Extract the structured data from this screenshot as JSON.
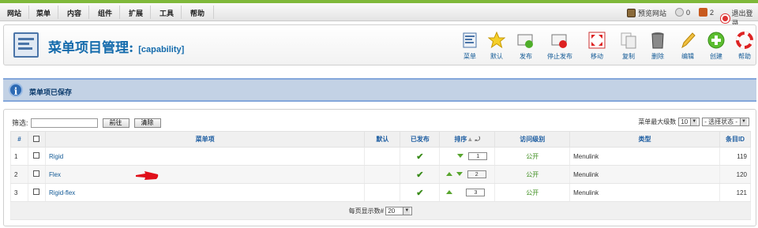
{
  "menubar": {
    "items": [
      "网站",
      "菜单",
      "内容",
      "组件",
      "扩展",
      "工具",
      "帮助"
    ],
    "preview_label": "预览网站",
    "visitors_count": "0",
    "users_count": "2",
    "logout_label": "退出登录"
  },
  "header": {
    "title": "菜单项目管理:",
    "subtitle": "[capability]"
  },
  "toolbar": {
    "buttons": [
      {
        "label": "菜单",
        "icon": "menu-icon"
      },
      {
        "label": "默认",
        "icon": "star-icon"
      },
      {
        "label": "发布",
        "icon": "publish-icon"
      },
      {
        "label": "停止发布",
        "icon": "unpublish-icon"
      },
      {
        "label": "移动",
        "icon": "move-icon"
      },
      {
        "label": "复制",
        "icon": "copy-icon"
      },
      {
        "label": "删除",
        "icon": "trash-icon"
      },
      {
        "label": "编辑",
        "icon": "edit-icon"
      },
      {
        "label": "创建",
        "icon": "add-icon"
      },
      {
        "label": "帮助",
        "icon": "help-icon"
      }
    ]
  },
  "message": {
    "text": "菜单项已保存"
  },
  "filter": {
    "label": "筛选:",
    "input_value": "",
    "go_label": "前往",
    "reset_label": "清除",
    "max_levels_label": "菜单最大级数",
    "max_levels_value": "10",
    "state_value": "- 选择状态 -"
  },
  "table": {
    "headers": {
      "num": "#",
      "item": "菜单项",
      "default": "默认",
      "published": "已发布",
      "order": "排序",
      "access": "访问级别",
      "type": "类型",
      "id": "条目ID"
    },
    "rows": [
      {
        "num": "1",
        "name": "Rigid",
        "order": "1",
        "access": "公开",
        "type": "Menulink",
        "id": "119"
      },
      {
        "num": "2",
        "name": "Flex",
        "order": "2",
        "access": "公开",
        "type": "Menulink",
        "id": "120"
      },
      {
        "num": "3",
        "name": "Rigid-flex",
        "order": "3",
        "access": "公开",
        "type": "Menulink",
        "id": "121"
      }
    ],
    "footer": {
      "per_page_label": "每页显示数#",
      "per_page_value": "20"
    }
  },
  "colors": {
    "accent": "#146bac",
    "published": "#3a8c1a",
    "message_bg": "#c3d2e5",
    "top_strip": "#7fb83a"
  }
}
